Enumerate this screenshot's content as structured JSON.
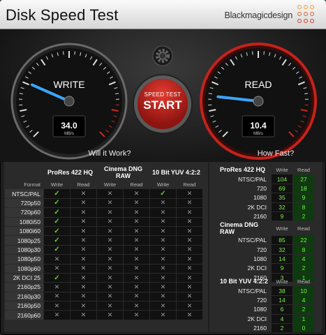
{
  "window": {
    "title": "Disk Speed Test",
    "brand": "Blackmagicdesign"
  },
  "gauges": {
    "write": {
      "label": "WRITE",
      "value": "34.0",
      "unit": "MB/s",
      "level": 0.34
    },
    "read": {
      "label": "READ",
      "value": "10.4",
      "unit": "MB/s",
      "level": 0.1
    }
  },
  "speed_button": {
    "top": "SPEED TEST",
    "main": "START"
  },
  "sections": {
    "will_it_work": "Will it Work?",
    "how_fast": "How Fast?"
  },
  "colors": {
    "ok": "#6ad12a",
    "accent_red": "#d32a20",
    "needle": "#3aa6ff"
  },
  "will_it_work": {
    "format_header": "Format",
    "codecs": [
      "ProRes 422 HQ",
      "Cinema DNG RAW",
      "10 Bit YUV 4:2:2"
    ],
    "subheaders": [
      "Write",
      "Read"
    ],
    "rows": [
      {
        "format": "NTSC/PAL",
        "v": [
          "ok",
          "no",
          "no",
          "no",
          "ok",
          "no"
        ]
      },
      {
        "format": "720p50",
        "v": [
          "ok",
          "no",
          "no",
          "no",
          "no",
          "no"
        ]
      },
      {
        "format": "720p60",
        "v": [
          "ok",
          "no",
          "no",
          "no",
          "no",
          "no"
        ]
      },
      {
        "format": "1080i50",
        "v": [
          "ok",
          "no",
          "no",
          "no",
          "no",
          "no"
        ]
      },
      {
        "format": "1080i60",
        "v": [
          "ok",
          "no",
          "no",
          "no",
          "no",
          "no"
        ]
      },
      {
        "format": "1080p25",
        "v": [
          "ok",
          "no",
          "no",
          "no",
          "no",
          "no"
        ]
      },
      {
        "format": "1080p30",
        "v": [
          "ok",
          "no",
          "no",
          "no",
          "no",
          "no"
        ]
      },
      {
        "format": "1080p50",
        "v": [
          "no",
          "no",
          "no",
          "no",
          "no",
          "no"
        ]
      },
      {
        "format": "1080p60",
        "v": [
          "no",
          "no",
          "no",
          "no",
          "no",
          "no"
        ]
      },
      {
        "format": "2K DCI 25",
        "v": [
          "ok",
          "no",
          "no",
          "no",
          "no",
          "no"
        ]
      },
      {
        "format": "2160p25",
        "v": [
          "no",
          "no",
          "no",
          "no",
          "no",
          "no"
        ]
      },
      {
        "format": "2160p30",
        "v": [
          "no",
          "no",
          "no",
          "no",
          "no",
          "no"
        ]
      },
      {
        "format": "2160p50",
        "v": [
          "no",
          "no",
          "no",
          "no",
          "no",
          "no"
        ]
      },
      {
        "format": "2160p60",
        "v": [
          "no",
          "no",
          "no",
          "no",
          "no",
          "no"
        ]
      }
    ]
  },
  "how_fast": {
    "subheaders": [
      "Write",
      "Read"
    ],
    "groups": [
      {
        "codec": "ProRes 422 HQ",
        "rows": [
          {
            "format": "NTSC/PAL",
            "write": "104",
            "read": "27"
          },
          {
            "format": "720",
            "write": "69",
            "read": "18"
          },
          {
            "format": "1080",
            "write": "35",
            "read": "9"
          },
          {
            "format": "2K DCI",
            "write": "32",
            "read": "8"
          },
          {
            "format": "2160",
            "write": "9",
            "read": "2"
          }
        ]
      },
      {
        "codec": "Cinema DNG RAW",
        "rows": [
          {
            "format": "NTSC/PAL",
            "write": "85",
            "read": "22"
          },
          {
            "format": "720",
            "write": "32",
            "read": "8"
          },
          {
            "format": "1080",
            "write": "14",
            "read": "4"
          },
          {
            "format": "2K DCI",
            "write": "9",
            "read": "2"
          },
          {
            "format": "2160",
            "write": "3",
            "read": "1"
          }
        ]
      },
      {
        "codec": "10 Bit YUV 4:2:2",
        "rows": [
          {
            "format": "NTSC/PAL",
            "write": "38",
            "read": "10"
          },
          {
            "format": "720",
            "write": "14",
            "read": "4"
          },
          {
            "format": "1080",
            "write": "6",
            "read": "2"
          },
          {
            "format": "2K DCI",
            "write": "4",
            "read": "1"
          },
          {
            "format": "2160",
            "write": "2",
            "read": "0"
          }
        ]
      }
    ]
  }
}
